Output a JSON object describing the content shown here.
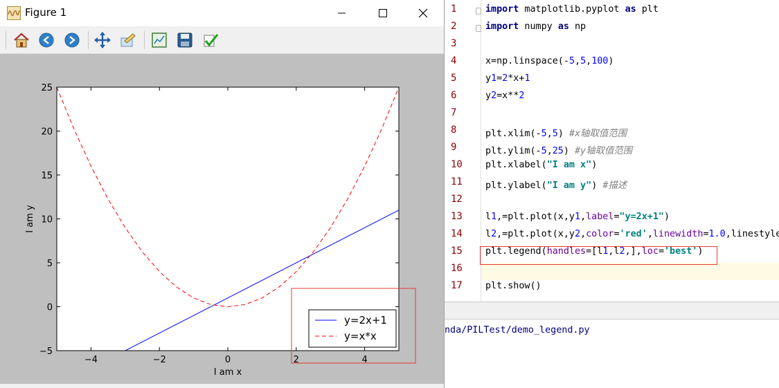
{
  "window": {
    "title": "Figure 1"
  },
  "toolbar": {
    "tools": [
      "home-icon",
      "back-icon",
      "forward-icon",
      "pan-icon",
      "configure-subplots-icon",
      "edit-axes-icon",
      "save-icon",
      "apply-icon"
    ]
  },
  "chart_data": {
    "type": "line",
    "xlabel": "I am x",
    "ylabel": "I am y",
    "xlim": [
      -5,
      5
    ],
    "ylim": [
      -5,
      25
    ],
    "xticks": [
      -4,
      -2,
      0,
      2,
      4
    ],
    "xtick_labels": [
      "−4",
      "−2",
      "0",
      "2",
      "4"
    ],
    "yticks": [
      -5,
      0,
      5,
      10,
      15,
      20,
      25
    ],
    "ytick_labels": [
      "−5",
      "0",
      "5",
      "10",
      "15",
      "20",
      "25"
    ],
    "series": [
      {
        "name": "y=2x+1",
        "color": "#0000ff",
        "linestyle": "solid",
        "x": [
          -5,
          5
        ],
        "y": [
          -9,
          11
        ]
      },
      {
        "name": "y=x*x",
        "color": "#ff0000",
        "linestyle": "dashed",
        "x": [
          -5,
          -4.5,
          -4,
          -3.5,
          -3,
          -2.5,
          -2,
          -1.5,
          -1,
          -0.5,
          0,
          0.5,
          1,
          1.5,
          2,
          2.5,
          3,
          3.5,
          4,
          4.5,
          5
        ],
        "y": [
          25,
          20.25,
          16,
          12.25,
          9,
          6.25,
          4,
          2.25,
          1,
          0.25,
          0,
          0.25,
          1,
          2.25,
          4,
          6.25,
          9,
          12.25,
          16,
          20.25,
          25
        ]
      }
    ],
    "legend": {
      "placement": "lower-right",
      "labels": [
        "y=2x+1",
        "y=x*x"
      ]
    },
    "grid": false
  },
  "editor": {
    "lines": [
      {
        "n": "1",
        "text": "import matplotlib.pyplot as plt"
      },
      {
        "n": "2",
        "text": "import numpy as np"
      },
      {
        "n": "3",
        "text": ""
      },
      {
        "n": "4",
        "text": "x=np.linspace(-5,5,100)"
      },
      {
        "n": "5",
        "text": "y1=2*x+1"
      },
      {
        "n": "6",
        "text": "y2=x**2"
      },
      {
        "n": "7",
        "text": ""
      },
      {
        "n": "8",
        "text": "plt.xlim(-5,5) #x轴取值范围"
      },
      {
        "n": "9",
        "text": "plt.ylim(-5,25) #y轴取值范围"
      },
      {
        "n": "10",
        "text": "plt.xlabel(\"I am x\")"
      },
      {
        "n": "11",
        "text": "plt.ylabel(\"I am y\") #描述"
      },
      {
        "n": "12",
        "text": ""
      },
      {
        "n": "13",
        "text": "l1,=plt.plot(x,y1,label=\"y=2x+1\")"
      },
      {
        "n": "14",
        "text": "l2,=plt.plot(x,y2,color='red',linewidth=1.0,linestyle"
      },
      {
        "n": "15",
        "text": "plt.legend(handles=[l1,l2,],loc='best')"
      },
      {
        "n": "16",
        "text": ""
      },
      {
        "n": "17",
        "text": "plt.show()"
      }
    ]
  },
  "console": {
    "path": "nda/PILTest/demo_legend.py"
  }
}
